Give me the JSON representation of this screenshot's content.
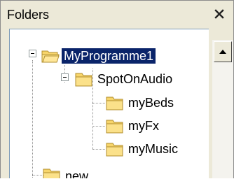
{
  "pane": {
    "title": "Folders",
    "close_glyph": "×"
  },
  "tree": {
    "root": {
      "label": "MyProgramme1",
      "expanded": true,
      "selected": true
    },
    "child": {
      "label": "SpotOnAudio",
      "expanded": true
    },
    "leaves": [
      {
        "label": "myBeds"
      },
      {
        "label": "myFx"
      },
      {
        "label": "myMusic"
      }
    ],
    "sibling": {
      "label": "new"
    }
  },
  "icons": {
    "close": "close-icon",
    "collapse": "minus-expander-icon",
    "folder": "folder-icon",
    "folder_open": "folder-open-icon",
    "scroll_up": "scroll-up-arrow-icon"
  },
  "colors": {
    "selection_bg": "#0a246a",
    "selection_text": "#ffffff",
    "folder_fill": "#f7d56b",
    "folder_stroke": "#b08d2c"
  }
}
